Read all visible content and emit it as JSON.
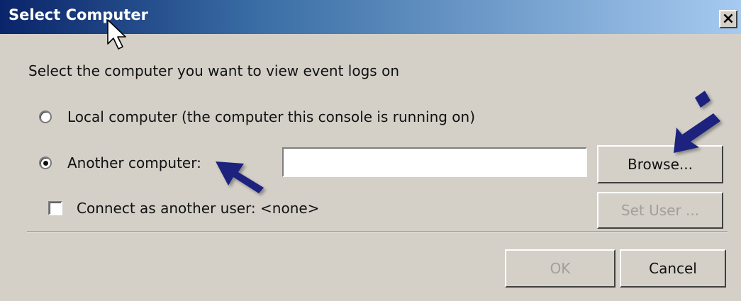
{
  "window": {
    "title": "Select Computer",
    "close_glyph": "×"
  },
  "prompt": "Select the computer you want to view event logs on",
  "options": {
    "local_label": "Local computer (the computer this console is running on)",
    "local_selected": false,
    "another_label": "Another computer:",
    "another_selected": true,
    "another_value": ""
  },
  "connect_as": {
    "label": "Connect as another user: <none>",
    "checked": false
  },
  "buttons": {
    "browse": "Browse...",
    "set_user": "Set User ...",
    "ok": "OK",
    "cancel": "Cancel"
  },
  "annotations": {
    "arrow_color": "#1a237e"
  },
  "icons": {
    "cursor": "mouse-cursor-icon",
    "close": "close-icon"
  }
}
